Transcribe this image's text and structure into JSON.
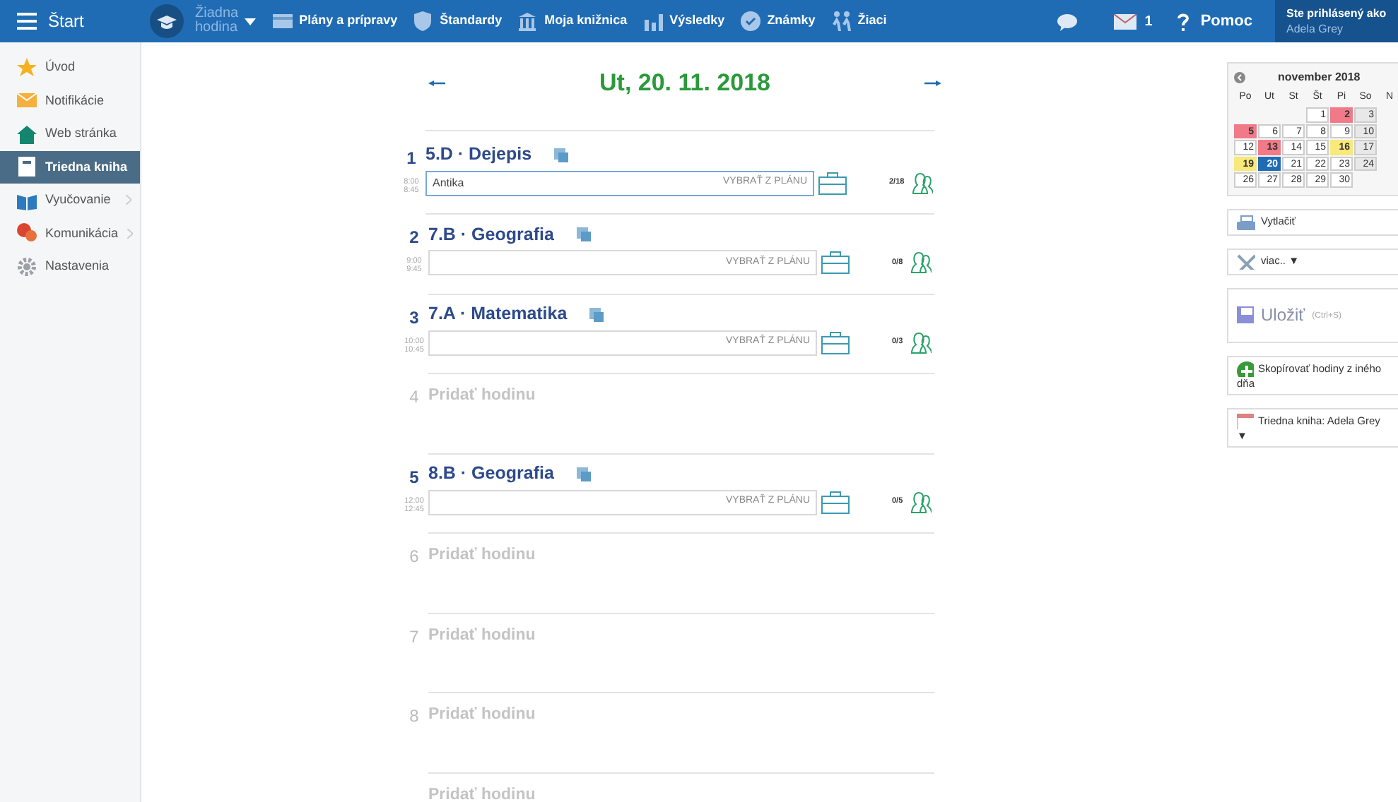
{
  "topbar": {
    "start": "Štart",
    "lesson_select": {
      "line1": "Žiadna",
      "line2": "hodina"
    },
    "nav": [
      {
        "label": "Plány a prípravy"
      },
      {
        "label": "Štandardy"
      },
      {
        "label": "Moja knižnica"
      },
      {
        "label": "Výsledky"
      },
      {
        "label": "Známky"
      },
      {
        "label": "Žiaci"
      }
    ],
    "messages_count": "1",
    "help": "Pomoc",
    "user": {
      "caption": "Ste prihlásený ako",
      "name": "Adela Grey"
    }
  },
  "sidebar": {
    "items": [
      {
        "label": "Úvod",
        "selected": false,
        "has_submenu": false
      },
      {
        "label": "Notifikácie",
        "selected": false,
        "has_submenu": false
      },
      {
        "label": "Web stránka",
        "selected": false,
        "has_submenu": false
      },
      {
        "label": "Triedna kniha",
        "selected": true,
        "has_submenu": false
      },
      {
        "label": "Vyučovanie",
        "selected": false,
        "has_submenu": true
      },
      {
        "label": "Komunikácia",
        "selected": false,
        "has_submenu": true
      },
      {
        "label": "Nastavenia",
        "selected": false,
        "has_submenu": false
      }
    ]
  },
  "day": {
    "title": "Ut, 20. 11. 2018"
  },
  "lessons": [
    {
      "kind": "lesson",
      "number": "1",
      "title": "5.D · Dejepis",
      "start": "8:00",
      "end": "8:45",
      "topic": "Antika",
      "plan_button": "VYBRAŤ Z PLÁNU",
      "attendance": "2/18",
      "focused": true
    },
    {
      "kind": "lesson",
      "number": "2",
      "title": "7.B · Geografia",
      "start": "9:00",
      "end": "9:45",
      "plan_button": "VYBRAŤ Z PLÁNU",
      "attendance": "0/8",
      "focused": false
    },
    {
      "kind": "lesson",
      "number": "3",
      "title": "7.A · Matematika",
      "start": "10:00",
      "end": "10:45",
      "plan_button": "VYBRAŤ Z PLÁNU",
      "attendance": "0/3",
      "focused": false
    },
    {
      "kind": "empty",
      "number": "4",
      "label": "Pridať hodinu"
    },
    {
      "kind": "lesson",
      "number": "5",
      "title": "8.B · Geografia",
      "start": "12:00",
      "end": "12:45",
      "plan_button": "VYBRAŤ Z PLÁNU",
      "attendance": "0/5",
      "focused": false
    },
    {
      "kind": "empty",
      "number": "6",
      "label": "Pridať hodinu"
    },
    {
      "kind": "empty",
      "number": "7",
      "label": "Pridať hodinu"
    },
    {
      "kind": "empty",
      "number": "8",
      "label": "Pridať hodinu"
    },
    {
      "kind": "empty",
      "label": "Pridať hodinu"
    }
  ],
  "calendar": {
    "month": "november 2018",
    "weekdays": [
      "Po",
      "Ut",
      "St",
      "Št",
      "Pi",
      "So",
      "N"
    ],
    "weeks": [
      [
        {
          "day": "1",
          "selected": false
        },
        {
          "day": "2",
          "color": "#f07a88",
          "selected": false
        },
        {
          "day": "3",
          "selected": false
        }
      ],
      [
        {
          "day": "5",
          "color": "#f07a88",
          "selected": false
        },
        {
          "day": "6",
          "selected": false
        },
        {
          "day": "7",
          "selected": false
        },
        {
          "day": "8",
          "selected": false
        },
        {
          "day": "9",
          "selected": false
        },
        {
          "day": "10",
          "selected": false
        }
      ],
      [
        {
          "day": "12",
          "selected": false
        },
        {
          "day": "13",
          "color": "#f07a88",
          "selected": false
        },
        {
          "day": "14",
          "selected": false
        },
        {
          "day": "15",
          "selected": false
        },
        {
          "day": "16",
          "color": "#f7e97a",
          "selected": false
        },
        {
          "day": "17",
          "selected": false
        }
      ],
      [
        {
          "day": "19",
          "color": "#f7e97a",
          "selected": false
        },
        {
          "day": "20",
          "selected": true
        },
        {
          "day": "21",
          "selected": false
        },
        {
          "day": "22",
          "selected": false
        },
        {
          "day": "23",
          "selected": false
        },
        {
          "day": "24",
          "selected": false
        }
      ],
      [
        {
          "day": "26",
          "selected": false
        },
        {
          "day": "27",
          "selected": false
        },
        {
          "day": "28",
          "selected": false
        },
        {
          "day": "29",
          "selected": false
        },
        {
          "day": "30",
          "selected": false
        }
      ]
    ]
  },
  "actions": [
    {
      "kind": "print",
      "label": "Vytlačiť"
    },
    {
      "kind": "more",
      "label": "viac.. ▼"
    },
    {
      "kind": "save",
      "label": "Uložiť",
      "hint": "(Ctrl+S)"
    },
    {
      "kind": "copy",
      "label": "Skopírovať hodiny z iného dňa"
    },
    {
      "kind": "book",
      "label": "Triedna kniha: Adela Grey ▼"
    }
  ]
}
